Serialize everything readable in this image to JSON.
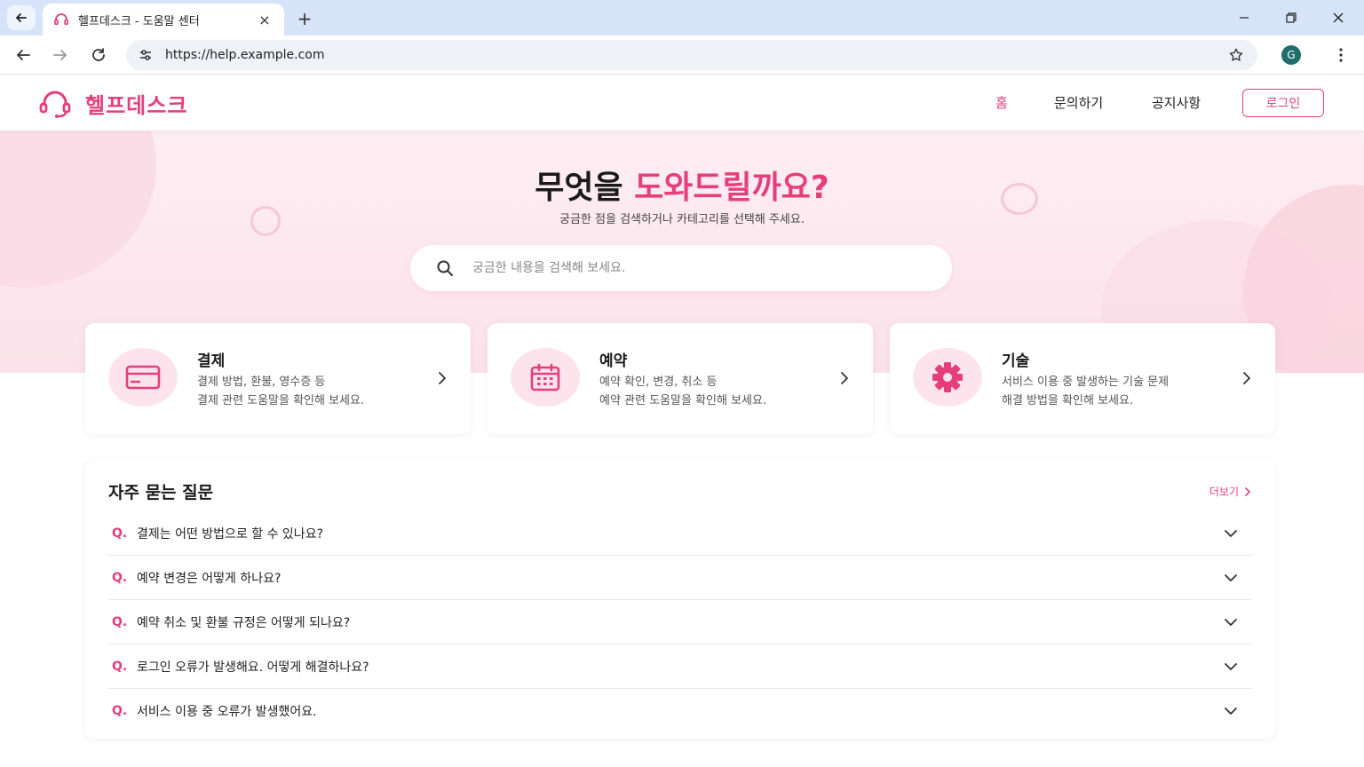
{
  "browser": {
    "tab_title": "헬프데스크 - 도움말 센터",
    "tab_close": "×",
    "new_tab": "+",
    "url": "https://help.example.com",
    "profile_initial": "G",
    "window_controls": {
      "minimize": "—",
      "maximize": "❐",
      "close": "✕"
    }
  },
  "header": {
    "logo_text": "헬프데스크",
    "nav": [
      {
        "label": "홈",
        "active": true
      },
      {
        "label": "문의하기",
        "active": false
      },
      {
        "label": "공지사항",
        "active": false
      }
    ],
    "login_label": "로그인"
  },
  "hero": {
    "title_main": "무엇을 ",
    "title_accent": "도와드릴까요?",
    "subtitle": "궁금한 점을 검색하거나 카테고리를 선택해 주세요.",
    "search_placeholder": "궁금한 내용을 검색해 보세요."
  },
  "categories": [
    {
      "icon": "credit-card-icon",
      "title": "결제",
      "line1": "결제 방법, 환불, 영수증 등",
      "line2": "결제 관련 도움말을 확인해 보세요."
    },
    {
      "icon": "calendar-icon",
      "title": "예약",
      "line1": "예약 확인, 변경, 취소 등",
      "line2": "예약 관련 도움말을 확인해 보세요."
    },
    {
      "icon": "gear-icon",
      "title": "기술",
      "line1": "서비스 이용 중 발생하는 기술 문제",
      "line2": "해결 방법을 확인해 보세요."
    }
  ],
  "faq": {
    "title": "자주 묻는 질문",
    "more_label": "더보기",
    "q_prefix": "Q.",
    "items": [
      "결제는 어떤 방법으로 할 수 있나요?",
      "예약 변경은 어떻게 하나요?",
      "예약 취소 및 환불 규정은 어떻게 되나요?",
      "로그인 오류가 발생해요. 어떻게 해결하나요?",
      "서비스 이용 중 오류가 발생했어요."
    ]
  },
  "colors": {
    "accent": "#e63e7b",
    "hero_bg": "#fdeef3",
    "icon_bg": "#fde4ec"
  }
}
